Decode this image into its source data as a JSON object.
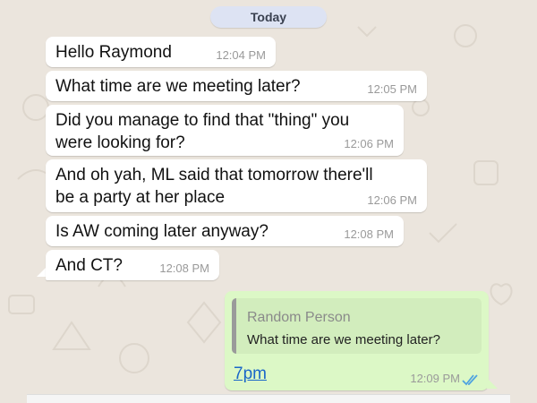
{
  "day_separator": "Today",
  "messages": [
    {
      "text": "Hello Raymond",
      "time": "12:04 PM"
    },
    {
      "text": "What time are we meeting later?",
      "time": "12:05 PM"
    },
    {
      "text_lines": [
        "Did you manage to find that \"thing\" you",
        "were looking for?"
      ],
      "time": "12:06 PM"
    },
    {
      "text_lines": [
        "And oh yah, ML said that tomorrow there'll",
        "be a party at her place"
      ],
      "time": "12:06 PM"
    },
    {
      "text": "Is AW coming later anyway?",
      "time": "12:08 PM"
    },
    {
      "text": "And CT?",
      "time": "12:08 PM"
    }
  ],
  "reply": {
    "quoted_author": "Random Person",
    "quoted_text": "What time are we meeting later?",
    "text": "7pm",
    "time": "12:09 PM",
    "status_icon": "double-check-icon"
  },
  "colors": {
    "chat_background": "#ebe5dd",
    "incoming_bubble": "#ffffff",
    "outgoing_bubble": "#dcf8c6",
    "link": "#1a67c8",
    "read_ticks": "#4fa3e0"
  }
}
